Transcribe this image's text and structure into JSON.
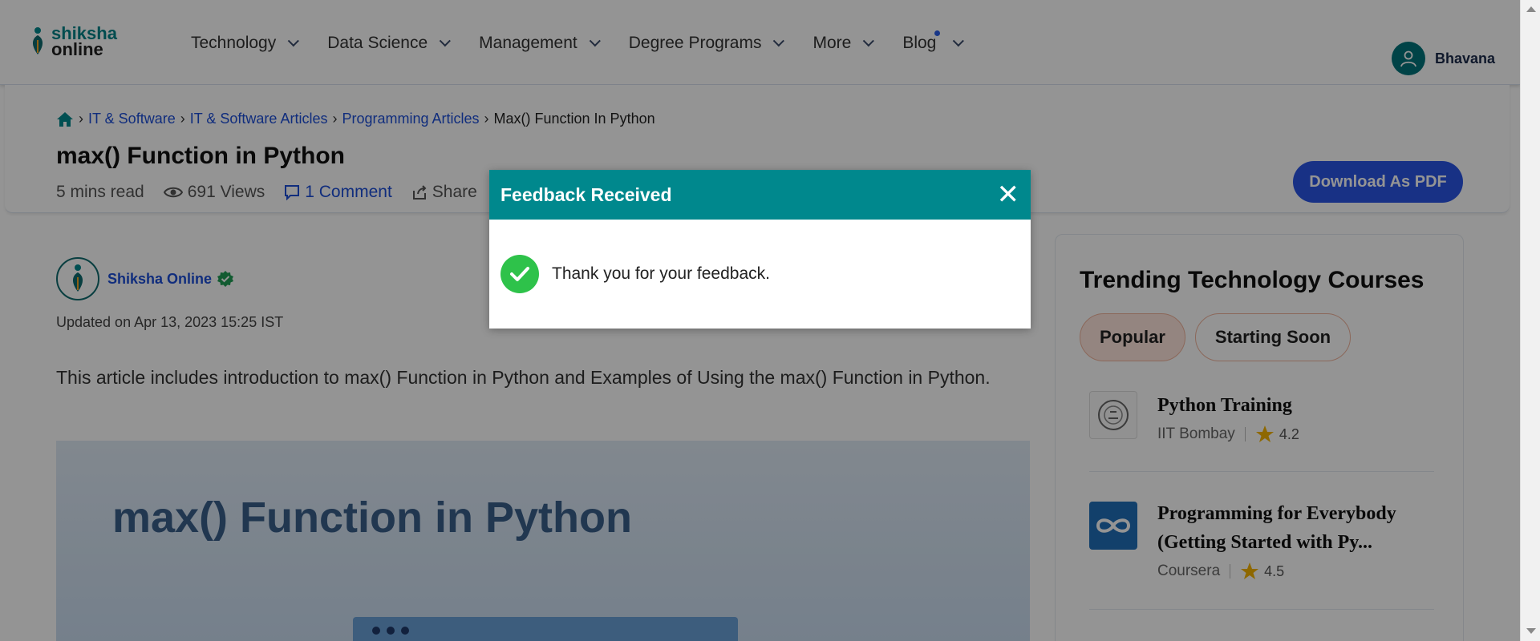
{
  "header": {
    "logo": {
      "line1": "shiksha",
      "line2": "online"
    },
    "nav": [
      {
        "label": "Technology"
      },
      {
        "label": "Data Science"
      },
      {
        "label": "Management"
      },
      {
        "label": "Degree Programs"
      },
      {
        "label": "More"
      },
      {
        "label": "Blog"
      }
    ],
    "user_name": "Bhavana"
  },
  "breadcrumb": {
    "items": [
      "IT & Software",
      "IT & Software Articles",
      "Programming Articles"
    ],
    "current": "Max() Function In Python"
  },
  "article": {
    "title": "max() Function in Python",
    "read_time": "5 mins read",
    "views": "691 Views",
    "comments": "1 Comment",
    "share": "Share",
    "download_label": "Download As PDF",
    "author": "Shiksha Online",
    "updated": "Updated on Apr 13, 2023 15:25 IST",
    "intro": "This article includes introduction to max() Function in Python and Examples of Using the max() Function in Python.",
    "hero_title": "max() Function in Python"
  },
  "sidebar": {
    "title": "Trending Technology Courses",
    "tabs": [
      "Popular",
      "Starting Soon"
    ],
    "courses": [
      {
        "name": "Python Training",
        "provider": "IIT Bombay",
        "rating": "4.2"
      },
      {
        "name": "Programming for Everybody (Getting Started with Py...",
        "provider": "Coursera",
        "rating": "4.5"
      }
    ]
  },
  "modal": {
    "title": "Feedback Received",
    "close": "✕",
    "message": "Thank you for your feedback."
  },
  "colors": {
    "accent": "#00888d",
    "link": "#1d4ed8",
    "button": "#2a55e6",
    "success": "#2ec24a"
  }
}
